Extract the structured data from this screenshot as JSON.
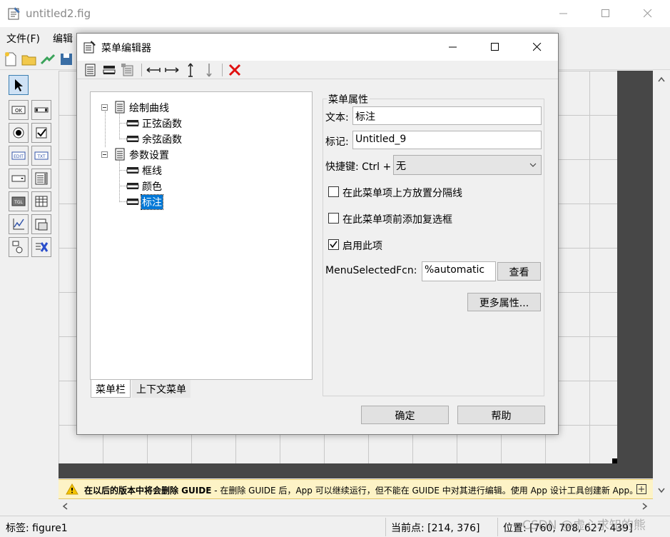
{
  "main_window": {
    "title": "untitled2.fig",
    "menu": [
      "文件(F)",
      "编辑"
    ],
    "toolbar_icons": [
      "new-file-icon",
      "open-folder-icon",
      "export-icon",
      "save-icon"
    ],
    "palette_tools": [
      {
        "name": "select-tool",
        "label": ""
      },
      {
        "name": "pushbutton-tool",
        "label": "OK"
      },
      {
        "name": "slider-tool",
        "label": ""
      },
      {
        "name": "radiobutton-tool",
        "label": ""
      },
      {
        "name": "checkbox-tool",
        "label": ""
      },
      {
        "name": "edit-text-tool",
        "label": "EDIT"
      },
      {
        "name": "static-text-tool",
        "label": "TXT"
      },
      {
        "name": "popup-menu-tool",
        "label": ""
      },
      {
        "name": "listbox-tool",
        "label": ""
      },
      {
        "name": "toggle-button-tool",
        "label": "TGL"
      },
      {
        "name": "table-tool",
        "label": ""
      },
      {
        "name": "axes-tool",
        "label": ""
      },
      {
        "name": "panel-tool",
        "label": ""
      },
      {
        "name": "button-group-tool",
        "label": ""
      },
      {
        "name": "activex-tool",
        "label": ""
      }
    ],
    "warning": {
      "bold": "在以后的版本中将会删除 GUIDE",
      "text": " - 在删除 GUIDE 后，App 可以继续运行，但不能在 GUIDE 中对其进行编辑。使用 App 设计工具创建新 App。"
    },
    "status": {
      "tag": "标签: figure1",
      "current_point": "当前点:  [214, 376]",
      "position": "位置: [760, 708, 627, 439]"
    },
    "watermark": "CSDN @虚心求知的熊"
  },
  "dialog": {
    "title": "菜单编辑器",
    "toolbar_icons": [
      "new-menu-icon",
      "new-menu-item-icon",
      "new-context-menu-icon",
      "move-left-icon",
      "move-right-icon",
      "move-up-icon",
      "move-down-icon",
      "delete-icon"
    ],
    "tree": [
      {
        "label": "绘制曲线",
        "level": 0,
        "expanded": true
      },
      {
        "label": "正弦函数",
        "level": 1
      },
      {
        "label": "余弦函数",
        "level": 1
      },
      {
        "label": "参数设置",
        "level": 0,
        "expanded": true
      },
      {
        "label": "框线",
        "level": 1
      },
      {
        "label": "颜色",
        "level": 1
      },
      {
        "label": "标注",
        "level": 1,
        "selected": true
      }
    ],
    "tabs": [
      "菜单栏",
      "上下文菜单"
    ],
    "props": {
      "group_title": "菜单属性",
      "text_label": "文本:",
      "text_value": "标注",
      "tag_label": "标记:",
      "tag_value": "Untitled_9",
      "accel_label": "快捷键: Ctrl +",
      "accel_value": "无",
      "separator_label": "在此菜单项上方放置分隔线",
      "separator_checked": false,
      "checkmark_label": "在此菜单项前添加复选框",
      "checkmark_checked": false,
      "enable_label": "启用此项",
      "enable_checked": true,
      "callback_label": "MenuSelectedFcn:",
      "callback_value": "%automatic",
      "view_button": "查看",
      "more_button": "更多属性..."
    },
    "ok_button": "确定",
    "help_button": "帮助"
  }
}
